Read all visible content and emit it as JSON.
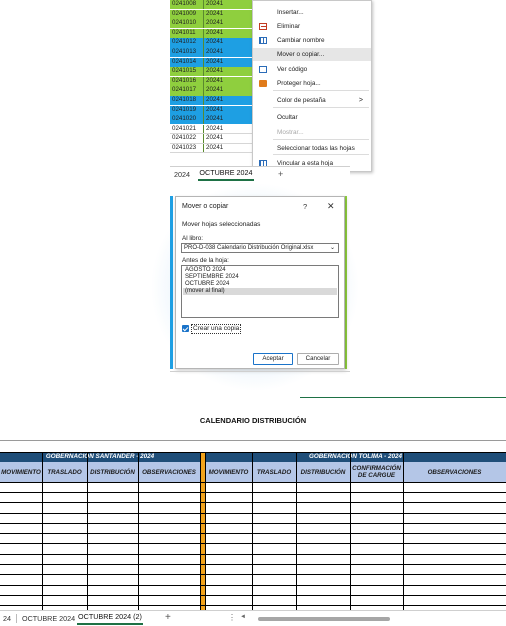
{
  "top_sheet": {
    "rows": [
      {
        "id": "0241008",
        "date": "20241",
        "color": "green"
      },
      {
        "id": "0241009",
        "date": "20241",
        "color": "green"
      },
      {
        "id": "0241010",
        "date": "20241",
        "color": "green"
      },
      {
        "id": "0241011",
        "date": "20241",
        "color": "green"
      },
      {
        "id": "0241012",
        "date": "20241",
        "color": "blue"
      },
      {
        "id": "0241013",
        "date": "20241",
        "color": "blue"
      },
      {
        "id": "0241014",
        "date": "20241",
        "color": "blue"
      },
      {
        "id": "0241015",
        "date": "20241",
        "color": "green"
      },
      {
        "id": "0241016",
        "date": "20241",
        "color": "green"
      },
      {
        "id": "0241017",
        "date": "20241",
        "color": "green"
      },
      {
        "id": "0241018",
        "date": "20241",
        "color": "blue"
      },
      {
        "id": "0241019",
        "date": "20241",
        "color": "blue"
      },
      {
        "id": "0241020",
        "date": "20241",
        "color": "blue"
      },
      {
        "id": "0241021",
        "date": "20241",
        "color": "white"
      },
      {
        "id": "0241022",
        "date": "20241",
        "color": "white"
      },
      {
        "id": "0241023",
        "date": "20241",
        "color": "white"
      }
    ],
    "tab_prev": "2024",
    "tab_active": "OCTUBRE 2024",
    "plus": "+"
  },
  "context_menu": {
    "items": [
      {
        "label": "Insertar...",
        "icon": "none",
        "highlight": false,
        "disabled": false
      },
      {
        "label": "Eliminar",
        "icon": "delete-sheet-icon",
        "highlight": false,
        "disabled": false
      },
      {
        "label": "Cambiar nombre",
        "icon": "rename-icon",
        "highlight": false,
        "disabled": false
      },
      {
        "label": "Mover o copiar...",
        "icon": "none",
        "highlight": true,
        "disabled": false
      },
      {
        "label": "Ver código",
        "icon": "view-code-icon",
        "highlight": false,
        "disabled": false
      },
      {
        "label": "Proteger hoja...",
        "icon": "protect-sheet-icon",
        "highlight": false,
        "disabled": false
      },
      {
        "label": "Color de pestaña",
        "icon": "none",
        "highlight": false,
        "disabled": false,
        "submenu": ">"
      },
      {
        "label": "Ocultar",
        "icon": "none",
        "highlight": false,
        "disabled": false
      },
      {
        "label": "Mostrar...",
        "icon": "none",
        "highlight": false,
        "disabled": true
      },
      {
        "label": "Seleccionar todas las hojas",
        "icon": "none",
        "highlight": false,
        "disabled": false
      },
      {
        "label": "Vincular a esta hoja",
        "icon": "link-sheet-icon",
        "highlight": false,
        "disabled": false
      }
    ]
  },
  "dialog": {
    "title": "Mover o copiar",
    "help": "?",
    "close": "✕",
    "subtitle": "Mover hojas seleccionadas",
    "book_label": "Al libro:",
    "book_value": "PRO-D-038 Calendario Distribución Original.xlsx",
    "before_label": "Antes de la hoja:",
    "before_options": [
      "AGOSTO 2024",
      "SEPTIEMBRE 2024",
      "OCTUBRE 2024",
      "(mover al final)"
    ],
    "selected_option": "(mover al final)",
    "copy_label": "Crear una copia",
    "copy_checked": true,
    "ok_label": "Aceptar",
    "cancel_label": "Cancelar"
  },
  "sheet": {
    "title": "CALENDARIO DISTRIBUCIÓN",
    "group_left": "GOBERNACIÓN SANTANDER - 2024",
    "group_right": "GOBERNACIÓN TOLIMA - 2024",
    "columns_left": [
      "MOVIMIENTO",
      "TRASLADO",
      "DISTRIBUCIÓN",
      "OBSERVACIONES"
    ],
    "columns_right": [
      "MOVIMIENTO",
      "TRASLADO",
      "DISTRIBUCIÓN",
      "CONFIRMACIÓN DE CARGUE",
      "OBSERVACIONES"
    ]
  },
  "sheet_bar": {
    "tab_prev": "24",
    "tab_oct": "OCTUBRE 2024",
    "tab_active": "OCTUBRE 2024 (2)",
    "plus": "+",
    "dots": "⋮",
    "left_arrow": "◄"
  },
  "colors": {
    "green": "#8fcf3e",
    "blue": "#1e9fe3",
    "header_dark": "#1f4e79",
    "header_light": "#b4c6e7",
    "separator_orange": "#f2a31b",
    "excel_green": "#1e7145"
  }
}
